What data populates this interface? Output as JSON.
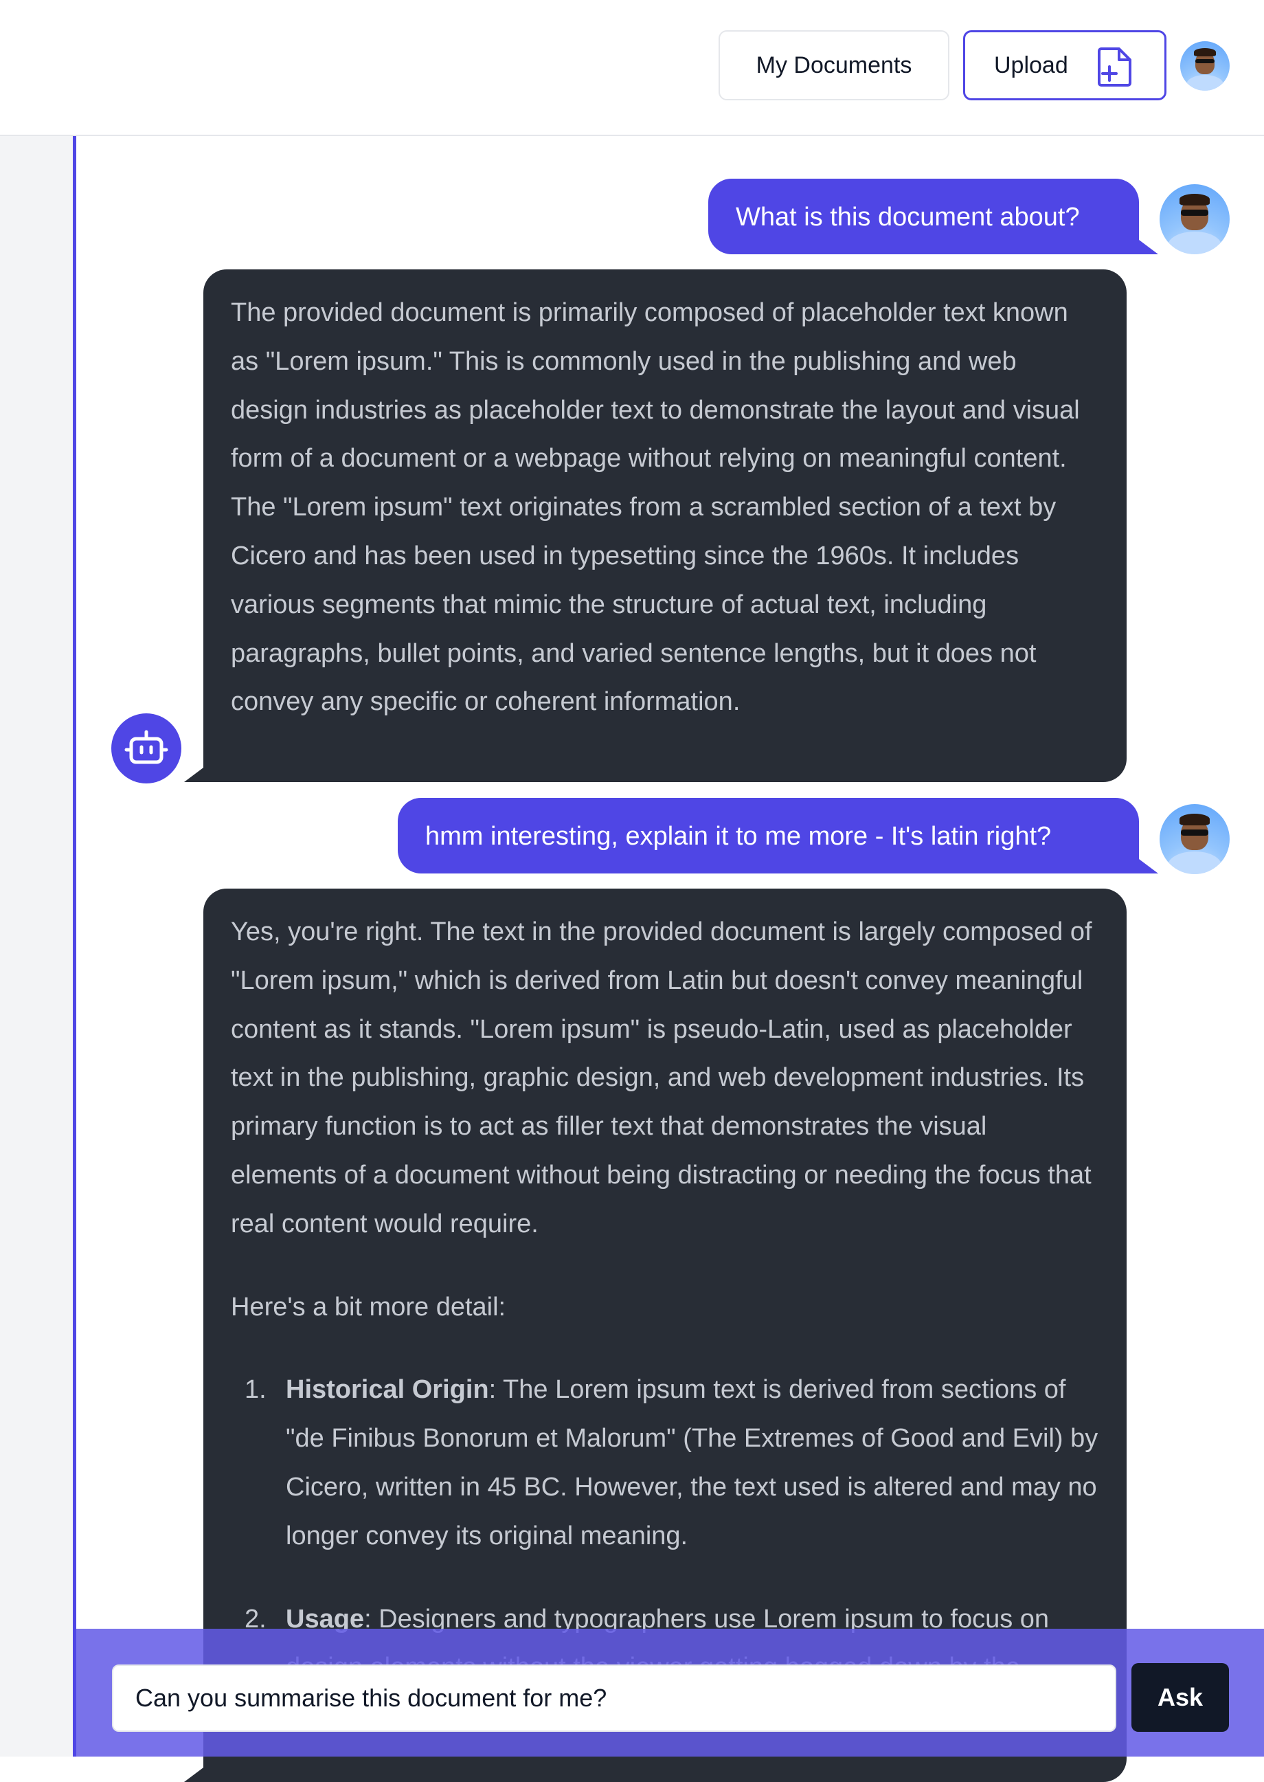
{
  "header": {
    "my_documents_label": "My Documents",
    "upload_label": "Upload",
    "upload_icon": "file-plus-icon",
    "avatar_icon": "user-avatar"
  },
  "colors": {
    "accent": "#4f46e5",
    "bot_bubble": "#282d36",
    "bot_text": "#c6cad2",
    "panel_background": "#f3f4f6",
    "ask_button": "#111827"
  },
  "messages": [
    {
      "role": "user",
      "text": "What is this document about?"
    },
    {
      "role": "bot",
      "paragraphs": [
        "The provided document is primarily composed of placeholder text known as \"Lorem ipsum.\" This is commonly used in the publishing and web design industries as placeholder text to demonstrate the layout and visual form of a document or a webpage without relying on meaningful content. The \"Lorem ipsum\" text originates from a scrambled section of a text by Cicero and has been used in typesetting since the 1960s. It includes various segments that mimic the structure of actual text, including paragraphs, bullet points, and varied sentence lengths, but it does not convey any specific or coherent information."
      ]
    },
    {
      "role": "user",
      "text": "hmm interesting, explain it to me more - It's latin right?"
    },
    {
      "role": "bot",
      "paragraphs": [
        "Yes, you're right. The text in the provided document is largely composed of \"Lorem ipsum,\" which is derived from Latin but doesn't convey meaningful content as it stands. \"Lorem ipsum\" is pseudo-Latin, used as placeholder text in the publishing, graphic design, and web development industries. Its primary function is to act as filler text that demonstrates the visual elements of a document without being distracting or needing the focus that real content would require.",
        "Here's a bit more detail:"
      ],
      "list": [
        {
          "number": "1.",
          "title": "Historical Origin",
          "text": ": The Lorem ipsum text is derived from sections of \"de Finibus Bonorum et Malorum\" (The Extremes of Good and Evil) by Cicero, written in 45 BC. However, the text used is altered and may no longer convey its original meaning."
        },
        {
          "number": "2.",
          "title": "Usage",
          "text": ": Designers and typographers use Lorem ipsum to focus on design elements without the viewer getting bogged down by the specifics of content. It helps clients to"
        }
      ]
    }
  ],
  "bot_avatar_icon": "robot-icon",
  "composer": {
    "input_value": "Can you summarise this document for me?",
    "ask_label": "Ask"
  }
}
